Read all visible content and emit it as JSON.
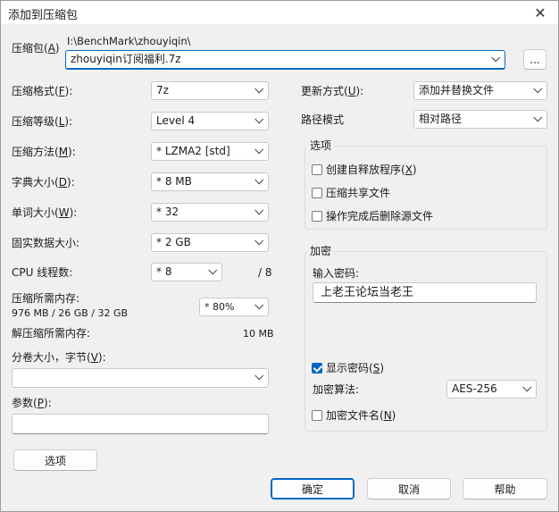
{
  "window": {
    "title": "添加到压缩包",
    "close_glyph": "✕"
  },
  "archive": {
    "label": "压缩包(",
    "accel": "A",
    "label_end": ")",
    "path": "I:\\BenchMark\\zhouyiqin\\",
    "filename": "zhouyiqin订阅福利.7z",
    "browse_label": "..."
  },
  "left": {
    "format": {
      "label": "压缩格式(",
      "accel": "F",
      "end": "):",
      "value": "7z"
    },
    "level": {
      "label": "压缩等级(",
      "accel": "L",
      "end": "):",
      "value": "Level 4"
    },
    "method": {
      "label": "压缩方法(",
      "accel": "M",
      "end": "):",
      "value": "*  LZMA2 [std]"
    },
    "dict": {
      "label": "字典大小(",
      "accel": "D",
      "end": "):",
      "value": "*  8 MB"
    },
    "word": {
      "label": "单词大小(",
      "accel": "W",
      "end": "):",
      "value": "*  32"
    },
    "solid": {
      "label": "固实数据大小:",
      "value": "*  2 GB"
    },
    "threads": {
      "label": "CPU 线程数:",
      "value": "*  8",
      "max": "/ 8"
    },
    "mem_comp": {
      "label": "压缩所需内存:",
      "detail": "976 MB / 26 GB / 32 GB",
      "value": "* 80%"
    },
    "mem_decomp": {
      "label": "解压缩所需内存:",
      "value": "10 MB"
    },
    "split": {
      "label": "分卷大小，字节(",
      "accel": "V",
      "end": "):",
      "value": ""
    },
    "params": {
      "label": "参数(",
      "accel": "P",
      "end": "):",
      "value": ""
    },
    "options_button": "选项"
  },
  "right": {
    "update": {
      "label": "更新方式(",
      "accel": "U",
      "end": "):",
      "value": "添加并替换文件"
    },
    "path_mode": {
      "label": "路径模式",
      "value": "相对路径"
    },
    "options_group": {
      "title": "选项",
      "sfx": {
        "label": "创建自释放程序(",
        "accel": "X",
        "end": ")",
        "checked": false
      },
      "shared": {
        "label": "压缩共享文件",
        "checked": false
      },
      "delete": {
        "label": "操作完成后删除源文件",
        "checked": false
      }
    },
    "encryption": {
      "title": "加密",
      "password_label": "输入密码:",
      "password_value": "上老王论坛当老王",
      "show_pw": {
        "label": "显示密码(",
        "accel": "S",
        "end": ")",
        "checked": true
      },
      "method_label": "加密算法:",
      "method_value": "AES-256",
      "encrypt_names": {
        "label": "加密文件名(",
        "accel": "N",
        "end": ")",
        "checked": false
      }
    }
  },
  "footer": {
    "ok": "确定",
    "cancel": "取消",
    "help": "帮助"
  },
  "colors": {
    "accent": "#0067c0",
    "dialog_bg": "#f0f0f0"
  }
}
